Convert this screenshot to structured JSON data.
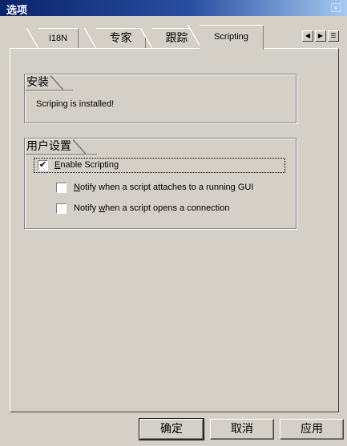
{
  "window": {
    "title": "选项"
  },
  "tabs": [
    {
      "label": "I18N"
    },
    {
      "label": "专家"
    },
    {
      "label": "跟踪"
    },
    {
      "label": "Scripting"
    }
  ],
  "install_group": {
    "title": "安装",
    "status_text": "Scriping is installed!"
  },
  "user_settings_group": {
    "title": "用户设置",
    "enable_scripting": {
      "label_prefix": "",
      "mnemonic": "E",
      "label_rest": "nable Scripting",
      "checked": true
    },
    "notify_attach": {
      "mnemonic": "N",
      "label_rest": "otify when a script attaches to a running GUI",
      "checked": false
    },
    "notify_connection": {
      "label_prefix": "Notify ",
      "mnemonic": "w",
      "label_rest": "hen a script opens a connection",
      "checked": false
    }
  },
  "buttons": {
    "ok": "确定",
    "cancel": "取消",
    "apply": "应用"
  },
  "check_mark": "✔"
}
